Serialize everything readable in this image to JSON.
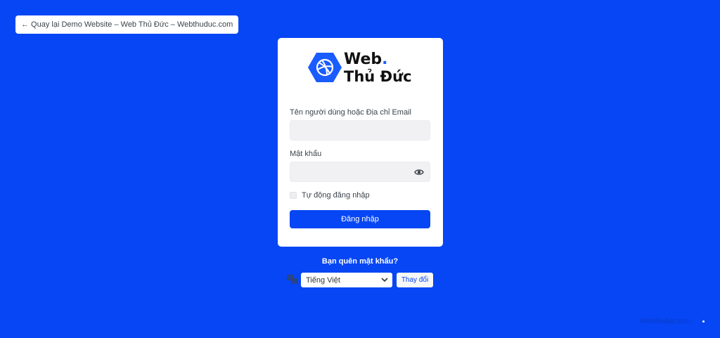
{
  "back_link": {
    "text": "← Quay lại Demo Website – Web Thủ Đức – Webthuduc.com"
  },
  "logo": {
    "line1": "Web",
    "dot": ".",
    "line2": "Thủ Đức"
  },
  "form": {
    "username_label": "Tên người dùng hoặc Địa chỉ Email",
    "username_value": "",
    "password_label": "Mật khẩu",
    "password_value": "",
    "remember_label": "Tự động đăng nhập",
    "submit_label": "Đăng nhập"
  },
  "lost_password": "Bạn quên mật khẩu?",
  "language": {
    "selected": "Tiếng Việt",
    "change_label": "Thay đổi"
  },
  "footer": {
    "watermark": "Webthuduc.com"
  },
  "colors": {
    "background": "#0646f4",
    "accent": "#0646f4",
    "logo_hex": "#1a5cff"
  },
  "icons": {
    "logo": "dribbble-ball-icon",
    "password_toggle": "eye-icon",
    "language": "translation-icon",
    "dropdown": "chevron-down-icon"
  }
}
